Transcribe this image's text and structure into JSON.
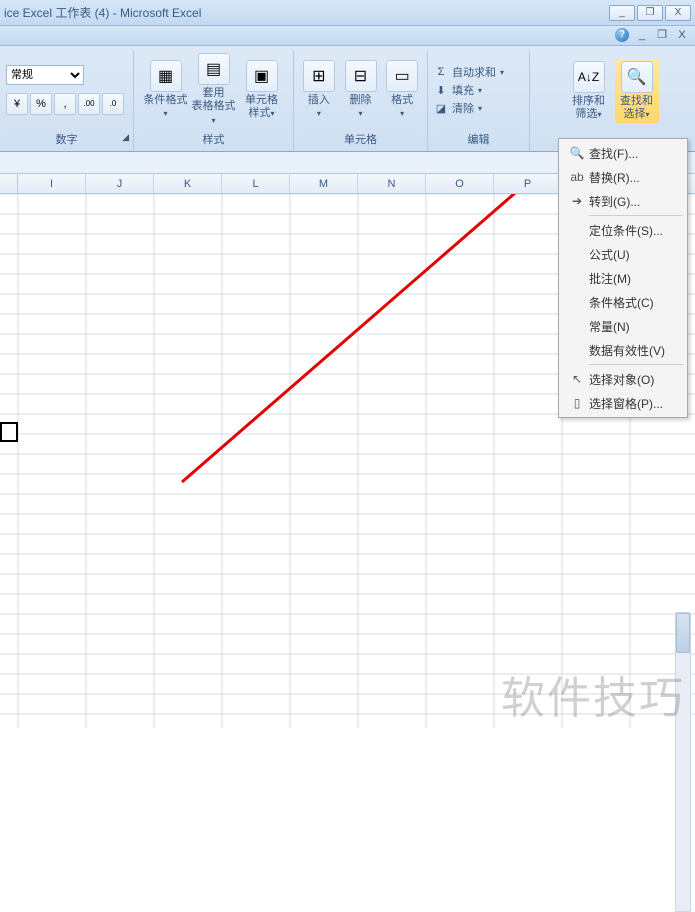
{
  "title": "ice Excel 工作表 (4) - Microsoft Excel",
  "win": {
    "min": "_",
    "restore": "❐",
    "close": "X"
  },
  "helprow": {
    "min": "_",
    "restore": "❐",
    "close": "X"
  },
  "ribbon": {
    "number": {
      "label": "数字",
      "format_selected": "常规",
      "btns": {
        "currency": "¥",
        "percent": "%",
        "comma": ",",
        "inc_dec": ".00",
        "dec_dec": ".0"
      }
    },
    "styles": {
      "label": "样式",
      "cond_fmt": "条件格式",
      "table_fmt": "套用\n表格格式",
      "cell_styles": "单元格\n样式"
    },
    "cells": {
      "label": "单元格",
      "insert": "插入",
      "delete": "删除",
      "format": "格式"
    },
    "editing": {
      "label": "编辑",
      "autosum": "自动求和",
      "fill": "填充",
      "clear": "清除",
      "sort_filter": "排序和\n筛选",
      "find_select": "查找和\n选择"
    }
  },
  "columns": [
    "I",
    "J",
    "K",
    "L",
    "M",
    "N",
    "O",
    "P"
  ],
  "dropdown": {
    "find": "查找(F)...",
    "replace": "替换(R)...",
    "goto": "转到(G)...",
    "goto_special": "定位条件(S)...",
    "formulas": "公式(U)",
    "comments": "批注(M)",
    "cond_fmt": "条件格式(C)",
    "constants": "常量(N)",
    "validation": "数据有效性(V)",
    "select_obj": "选择对象(O)",
    "select_pane": "选择窗格(P)..."
  },
  "watermark": "软件技巧"
}
